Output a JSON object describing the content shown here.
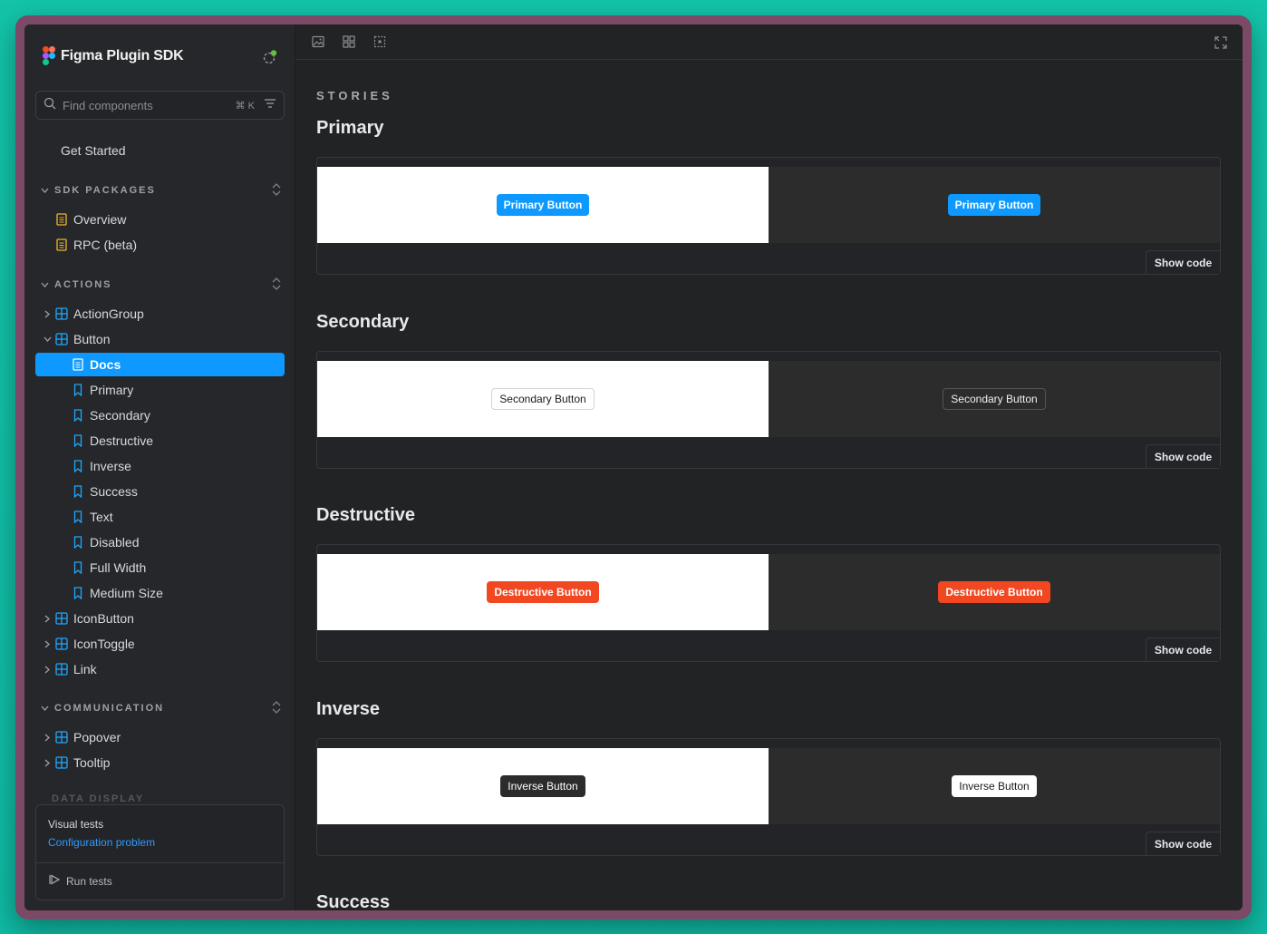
{
  "sidebar": {
    "brand": "Figma Plugin SDK",
    "search": {
      "placeholder": "Find components",
      "shortcut": "⌘ K"
    },
    "get_started": "Get Started",
    "sections": {
      "sdk_packages": {
        "label": "SDK PACKAGES",
        "items": [
          "Overview",
          "RPC (beta)"
        ]
      },
      "actions": {
        "label": "ACTIONS",
        "components": [
          "ActionGroup",
          "Button",
          "IconButton",
          "IconToggle",
          "Link"
        ],
        "button_children": [
          "Docs",
          "Primary",
          "Secondary",
          "Destructive",
          "Inverse",
          "Success",
          "Text",
          "Disabled",
          "Full Width",
          "Medium Size"
        ]
      },
      "communication": {
        "label": "COMMUNICATION",
        "components": [
          "Popover",
          "Tooltip"
        ]
      },
      "data_display": {
        "label": "DATA DISPLAY"
      }
    },
    "tests": {
      "title": "Visual tests",
      "status": "Configuration problem",
      "run": "Run tests"
    }
  },
  "toolbar": {
    "icons": [
      "image-icon",
      "grid-icon",
      "outline-icon",
      "fullscreen-icon"
    ]
  },
  "docs": {
    "eyebrow": "STORIES",
    "show_code": "Show code",
    "stories": [
      {
        "title": "Primary",
        "button": "Primary Button"
      },
      {
        "title": "Secondary",
        "button": "Secondary Button"
      },
      {
        "title": "Destructive",
        "button": "Destructive Button"
      },
      {
        "title": "Inverse",
        "button": "Inverse Button"
      },
      {
        "title": "Success"
      }
    ]
  },
  "colors": {
    "accent": "#0d99ff",
    "destructive": "#f24822",
    "frame": "#7a4a66",
    "background": "#13c4a8"
  }
}
